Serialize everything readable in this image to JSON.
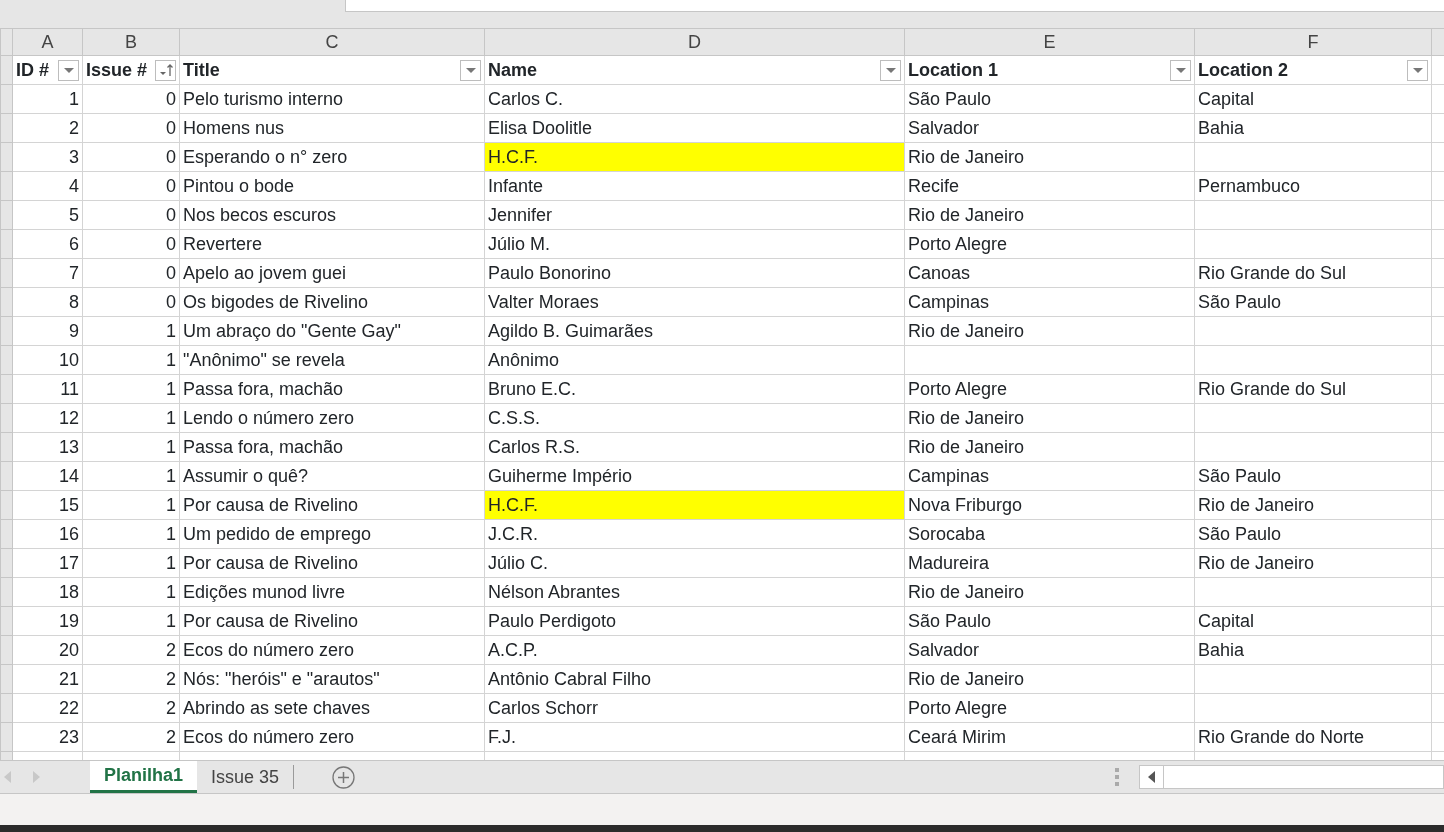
{
  "column_letters": [
    "A",
    "B",
    "C",
    "D",
    "E",
    "F"
  ],
  "columns": [
    {
      "label": "ID #",
      "sorted": false
    },
    {
      "label": "Issue #",
      "sorted": true
    },
    {
      "label": "Title",
      "sorted": false
    },
    {
      "label": "Name",
      "sorted": false
    },
    {
      "label": "Location 1",
      "sorted": false
    },
    {
      "label": "Location 2",
      "sorted": false
    }
  ],
  "rows": [
    {
      "id": "1",
      "issue": "0",
      "title": "Pelo turismo interno",
      "name": "Carlos C.",
      "location_1": "São Paulo",
      "location_2": "Capital",
      "highlighted": false
    },
    {
      "id": "2",
      "issue": "0",
      "title": "Homens nus",
      "name": "Elisa Doolitle",
      "location_1": "Salvador",
      "location_2": "Bahia",
      "highlighted": false
    },
    {
      "id": "3",
      "issue": "0",
      "title": "Esperando o n° zero",
      "name": "H.C.F.",
      "location_1": "Rio de Janeiro",
      "highlighted": true
    },
    {
      "id": "4",
      "issue": "0",
      "title": "Pintou o bode",
      "name": "Infante",
      "location_1": "Recife",
      "location_2": "Pernambuco",
      "highlighted": false
    },
    {
      "id": "5",
      "issue": "0",
      "title": "Nos becos escuros",
      "name": "Jennifer",
      "location_1": "Rio de Janeiro",
      "highlighted": false
    },
    {
      "id": "6",
      "issue": "0",
      "title": "Revertere",
      "name": "Júlio M.",
      "location_1": "Porto Alegre",
      "highlighted": false
    },
    {
      "id": "7",
      "issue": "0",
      "title": "Apelo ao jovem guei",
      "name": "Paulo Bonorino",
      "location_1": "Canoas",
      "location_2": "Rio Grande do Sul",
      "highlighted": false
    },
    {
      "id": "8",
      "issue": "0",
      "title": "Os bigodes de Rivelino",
      "name": "Valter Moraes",
      "location_1": "Campinas",
      "location_2": "São Paulo",
      "highlighted": false
    },
    {
      "id": "9",
      "issue": "1",
      "title": "Um abraço do \"Gente Gay\"",
      "name": "Agildo B. Guimarães",
      "location_1": "Rio de Janeiro",
      "highlighted": false
    },
    {
      "id": "10",
      "issue": "1",
      "title": "\"Anônimo\" se revela",
      "name": "Anônimo",
      "highlighted": false
    },
    {
      "id": "11",
      "issue": "1",
      "title": "Passa fora, machão",
      "name": "Bruno E.C.",
      "location_1": "Porto Alegre",
      "location_2": "Rio Grande do Sul",
      "highlighted": false
    },
    {
      "id": "12",
      "issue": "1",
      "title": "Lendo o número zero",
      "name": "C.S.S.",
      "location_1": "Rio de Janeiro",
      "highlighted": false
    },
    {
      "id": "13",
      "issue": "1",
      "title": "Passa fora, machão",
      "name": "Carlos R.S.",
      "location_1": "Rio de Janeiro",
      "highlighted": false
    },
    {
      "id": "14",
      "issue": "1",
      "title": "Assumir o quê?",
      "name": "Guiherme Império",
      "location_1": "Campinas",
      "location_2": "São Paulo",
      "highlighted": false
    },
    {
      "id": "15",
      "issue": "1",
      "title": "Por causa de Rivelino",
      "name": "H.C.F.",
      "location_1": "Nova Friburgo",
      "location_2": "Rio de Janeiro",
      "highlighted": true
    },
    {
      "id": "16",
      "issue": "1",
      "title": "Um pedido de emprego",
      "name": "J.C.R.",
      "location_1": "Sorocaba",
      "location_2": "São Paulo",
      "highlighted": false
    },
    {
      "id": "17",
      "issue": "1",
      "title": "Por causa de Rivelino",
      "name": "Júlio C.",
      "location_1": "Madureira",
      "location_2": "Rio de Janeiro",
      "highlighted": false
    },
    {
      "id": "18",
      "issue": "1",
      "title": "Edições munod livre",
      "name": "Nélson Abrantes",
      "location_1": "Rio de Janeiro",
      "highlighted": false
    },
    {
      "id": "19",
      "issue": "1",
      "title": "Por causa de Rivelino",
      "name": "Paulo Perdigoto",
      "location_1": "São Paulo",
      "location_2": "Capital",
      "highlighted": false
    },
    {
      "id": "20",
      "issue": "2",
      "title": "Ecos do número zero",
      "name": "A.C.P.",
      "location_1": "Salvador",
      "location_2": "Bahia",
      "highlighted": false
    },
    {
      "id": "21",
      "issue": "2",
      "title": "Nós: \"heróis\" e \"arautos\"",
      "name": "Antônio Cabral Filho",
      "location_1": "Rio de Janeiro",
      "highlighted": false
    },
    {
      "id": "22",
      "issue": "2",
      "title": "Abrindo as sete chaves",
      "name": "Carlos Schorr",
      "location_1": "Porto Alegre",
      "highlighted": false
    },
    {
      "id": "23",
      "issue": "2",
      "title": "Ecos do número zero",
      "name": "F.J.",
      "location_1": "Ceará Mirim",
      "location_2": "Rio Grande do Norte",
      "highlighted": false
    }
  ],
  "sheet_tabs": [
    {
      "label": "Planilha1",
      "selected": true
    },
    {
      "label": "Issue 35",
      "selected": false
    }
  ]
}
